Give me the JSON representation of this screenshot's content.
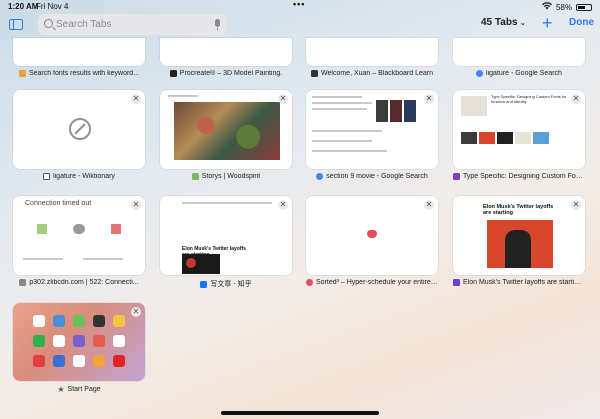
{
  "status": {
    "time": "1:20 AM",
    "date": "Fri Nov 4",
    "battery": "58%",
    "battery_level": 0.58
  },
  "toolbar": {
    "search_placeholder": "Search Tabs",
    "tab_count": "45 Tabs",
    "add_label": "+",
    "done_label": "Done"
  },
  "colors": {
    "accent": "#2b7cf7",
    "background_top": "#c9dbe7",
    "background_bottom": "#f4e4d6"
  },
  "tabs": [
    {
      "title": "Search fonts results with keyword...",
      "favicon": "orange-search-icon",
      "color": "#f0a030"
    },
    {
      "title": "Procreate® – 3D Model Painting.",
      "favicon": "procreate-icon",
      "color": "#222222"
    },
    {
      "title": "Welcome, Xuan – Blackboard Learn",
      "favicon": "blackboard-icon",
      "color": "#333333"
    },
    {
      "title": "ligature - Google Search",
      "favicon": "google-g-icon",
      "color": "#4285f4"
    },
    {
      "title": "ligature - Wiktionary",
      "favicon": "wiktionary-icon",
      "color": "#555555"
    },
    {
      "title": "Storys | Woodspirit",
      "favicon": "storys-icon",
      "color": "#7bb661"
    },
    {
      "title": "section 9 movie - Google Search",
      "favicon": "google-g-icon",
      "color": "#4285f4"
    },
    {
      "title": "Type Specific: Designing Custom Fon...",
      "favicon": "type-specific-icon",
      "color": "#7b3fbf"
    },
    {
      "title": "p302.zlibcdn.com | 522: Connecti...",
      "favicon": "letter-v-icon",
      "color": "#888888"
    },
    {
      "title": "写文章 - 知乎",
      "favicon": "zhihu-icon",
      "color": "#1772f6"
    },
    {
      "title": "Sorted³ – Hyper-schedule your entire d...",
      "favicon": "sorted-icon",
      "color": "#e84a5f"
    },
    {
      "title": "Elon Musk's Twitter layoffs are starting...",
      "favicon": "verge-icon",
      "color": "#6a3fd1"
    },
    {
      "title": "Start Page",
      "favicon": "star-icon",
      "color": "#555555"
    }
  ],
  "thumbnails": {
    "connection_title": "Connection timed out",
    "elon_headline": "Elon Musk's Twitter layoffs are starting",
    "type_specific_headline": "Type Specific: Designing Custom Fonts for function and identity",
    "zhihu_headline": "Elon Musk's Twitter layoffs are starting"
  }
}
